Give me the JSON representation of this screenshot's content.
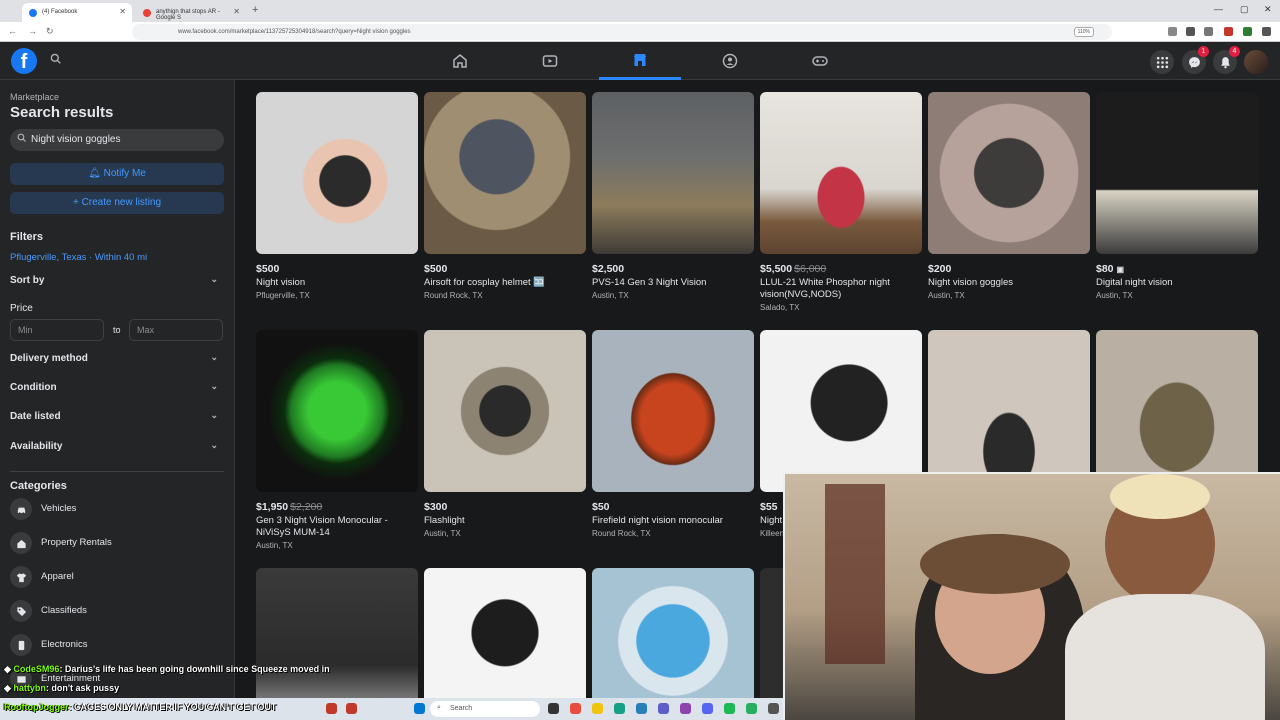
{
  "browser": {
    "tabs": [
      {
        "label": "(4) Facebook"
      },
      {
        "label": "anythign that stops AR - Google S"
      }
    ],
    "url": "www.facebook.com/marketplace/113725725304918/search?query=Night vision goggles",
    "zoom": "110%"
  },
  "header": {
    "messenger_badge": "1",
    "notifications_badge": "4"
  },
  "sidebar": {
    "breadcrumb": "Marketplace",
    "title": "Search results",
    "search_value": "Night vision goggles",
    "notify_label": "Notify Me",
    "create_label": "Create new listing",
    "filters_heading": "Filters",
    "location": "Pflugerville, Texas · Within 40 mi",
    "sort_label": "Sort by",
    "price_label": "Price",
    "min_placeholder": "Min",
    "max_placeholder": "Max",
    "price_to": "to",
    "delivery_label": "Delivery method",
    "condition_label": "Condition",
    "date_label": "Date listed",
    "availability_label": "Availability",
    "categories_heading": "Categories",
    "categories": [
      {
        "label": "Vehicles",
        "icon": "car-icon"
      },
      {
        "label": "Property Rentals",
        "icon": "house-icon"
      },
      {
        "label": "Apparel",
        "icon": "shirt-icon"
      },
      {
        "label": "Classifieds",
        "icon": "tag-icon"
      },
      {
        "label": "Electronics",
        "icon": "phone-icon"
      },
      {
        "label": "Entertainment",
        "icon": "film-icon"
      }
    ]
  },
  "listings": [
    {
      "price": "$500",
      "old": "",
      "title": "Night vision",
      "location": "Pflugerville, TX"
    },
    {
      "price": "$500",
      "old": "",
      "title": "Airsoft for cosplay helmet 🈁",
      "location": "Round Rock, TX"
    },
    {
      "price": "$2,500",
      "old": "",
      "title": "PVS-14 Gen 3 Night Vision",
      "location": "Austin, TX"
    },
    {
      "price": "$5,500",
      "old": "$6,000",
      "title": "LLUL-21 White Phosphor night vision(NVG,NODS)",
      "location": "Salado, TX"
    },
    {
      "price": "$200",
      "old": "",
      "title": "Night vision goggles",
      "location": "Austin, TX"
    },
    {
      "price": "$80",
      "old": "",
      "title": "Digital night vision",
      "location": "Austin, TX"
    },
    {
      "price": "$1,950",
      "old": "$2,200",
      "title": "Gen 3 Night Vision Monocular - NiViSyS MUM-14",
      "location": "Austin, TX"
    },
    {
      "price": "$300",
      "old": "",
      "title": "Flashlight",
      "location": "Austin, TX"
    },
    {
      "price": "$50",
      "old": "",
      "title": "Firefield night vision monocular",
      "location": "Round Rock, TX"
    },
    {
      "price": "$55",
      "old": "",
      "title": "Night",
      "location": "Killeen"
    },
    {
      "price": "",
      "old": "",
      "title": "",
      "location": ""
    },
    {
      "price": "",
      "old": "",
      "title": "",
      "location": ""
    },
    {
      "price": "",
      "old": "",
      "title": "",
      "location": ""
    },
    {
      "price": "",
      "old": "",
      "title": "",
      "location": ""
    },
    {
      "price": "",
      "old": "",
      "title": "",
      "location": ""
    },
    {
      "price": "",
      "old": "",
      "title": "",
      "location": ""
    }
  ],
  "chat": [
    {
      "user": "CodeSM96",
      "message": ": Darius's life has been going downhill since Squeeze moved in"
    },
    {
      "user": "hattybn",
      "message": ": don't ask pussy"
    },
    {
      "user": "RooftopJogger",
      "message": ": CAGES ONLY MATTER IF YOU CAN'T GET OUT"
    }
  ],
  "taskbar": {
    "search_placeholder": "Search"
  }
}
